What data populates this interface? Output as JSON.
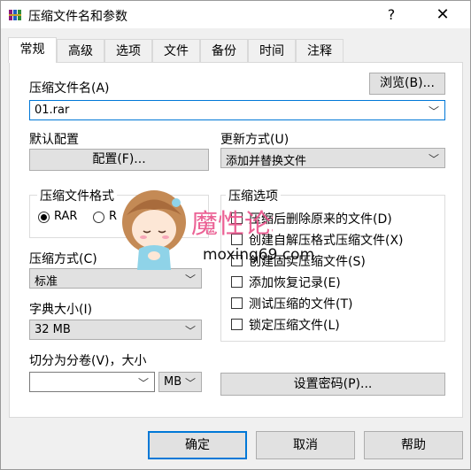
{
  "window": {
    "title": "压缩文件名和参数",
    "help_glyph": "?",
    "close_glyph": "✕",
    "app_icon": "winrar-books-icon"
  },
  "tabs": [
    {
      "label": "常规",
      "active": true
    },
    {
      "label": "高级"
    },
    {
      "label": "选项"
    },
    {
      "label": "文件"
    },
    {
      "label": "备份"
    },
    {
      "label": "时间"
    },
    {
      "label": "注释"
    }
  ],
  "archive_name": {
    "label": "压缩文件名(A)",
    "browse_label": "浏览(B)...",
    "value": "01.rar"
  },
  "default_profile": {
    "label": "默认配置",
    "button_label": "配置(F)..."
  },
  "update_mode": {
    "label": "更新方式(U)",
    "value": "添加并替换文件"
  },
  "archive_format": {
    "label": "压缩文件格式",
    "options": [
      "RAR",
      "RAR4",
      "ZIP"
    ],
    "visible_text": [
      "RAR",
      "R",
      "IP"
    ],
    "selected": "RAR"
  },
  "compression_method": {
    "label": "压缩方式(C)",
    "value": "标准"
  },
  "dictionary_size": {
    "label": "字典大小(I)",
    "value": "32 MB"
  },
  "split_volumes": {
    "label": "切分为分卷(V)，大小",
    "value": "",
    "unit": "MB"
  },
  "archive_options": {
    "label": "压缩选项",
    "items": [
      {
        "label": "压缩后删除原来的文件(D)",
        "checked": false
      },
      {
        "label": "创建自解压格式压缩文件(X)",
        "checked": false
      },
      {
        "label": "创建固实压缩文件(S)",
        "checked": false
      },
      {
        "label": "添加恢复记录(E)",
        "checked": false
      },
      {
        "label": "测试压缩的文件(T)",
        "checked": false
      },
      {
        "label": "锁定压缩文件(L)",
        "checked": false
      }
    ]
  },
  "set_password_label": "设置密码(P)...",
  "watermark": {
    "title": "魔性论坛",
    "url": "moxing69.com",
    "title_color": "#e9528a"
  },
  "footer": {
    "ok_label": "确定",
    "cancel_label": "取消",
    "help_label": "帮助"
  }
}
